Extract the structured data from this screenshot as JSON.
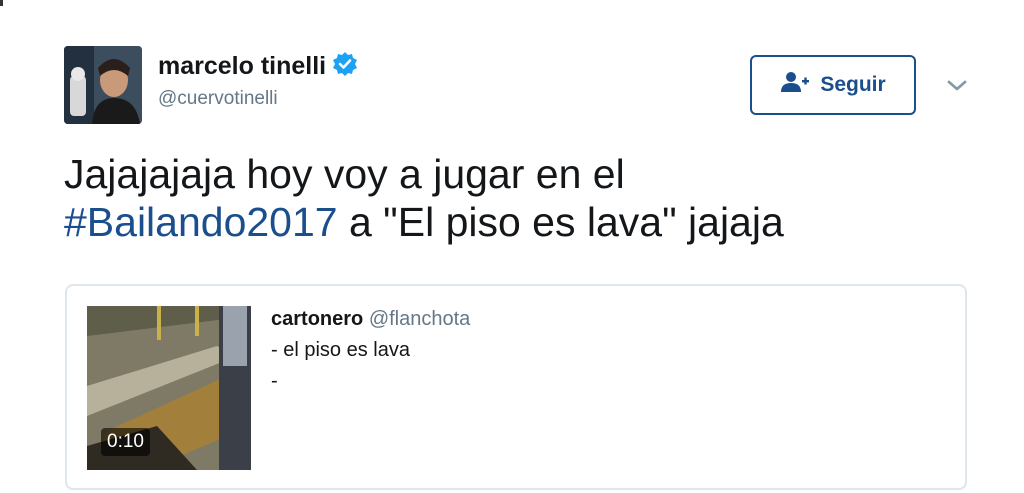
{
  "tweet": {
    "author": {
      "name": "marcelo tinelli",
      "handle": "@cuervotinelli",
      "verified": true
    },
    "follow_label": "Seguir",
    "text_line1": "Jajajajaja hoy voy a jugar en el",
    "hashtag": "#Bailando2017",
    "text_after_hashtag": " a \"El piso es lava\" jajaja",
    "icons": {
      "follow": "add-user-icon",
      "menu": "chevron-down-icon",
      "verified": "verified-badge-icon"
    }
  },
  "quote": {
    "author_name": "cartonero",
    "author_handle": "@flanchota",
    "line1": "- el piso es lava",
    "line2": "-",
    "video_duration": "0:10"
  },
  "colors": {
    "link": "#1b4e8c",
    "verified": "#1da1f2",
    "muted": "#657786",
    "border": "#dfe6ec"
  }
}
